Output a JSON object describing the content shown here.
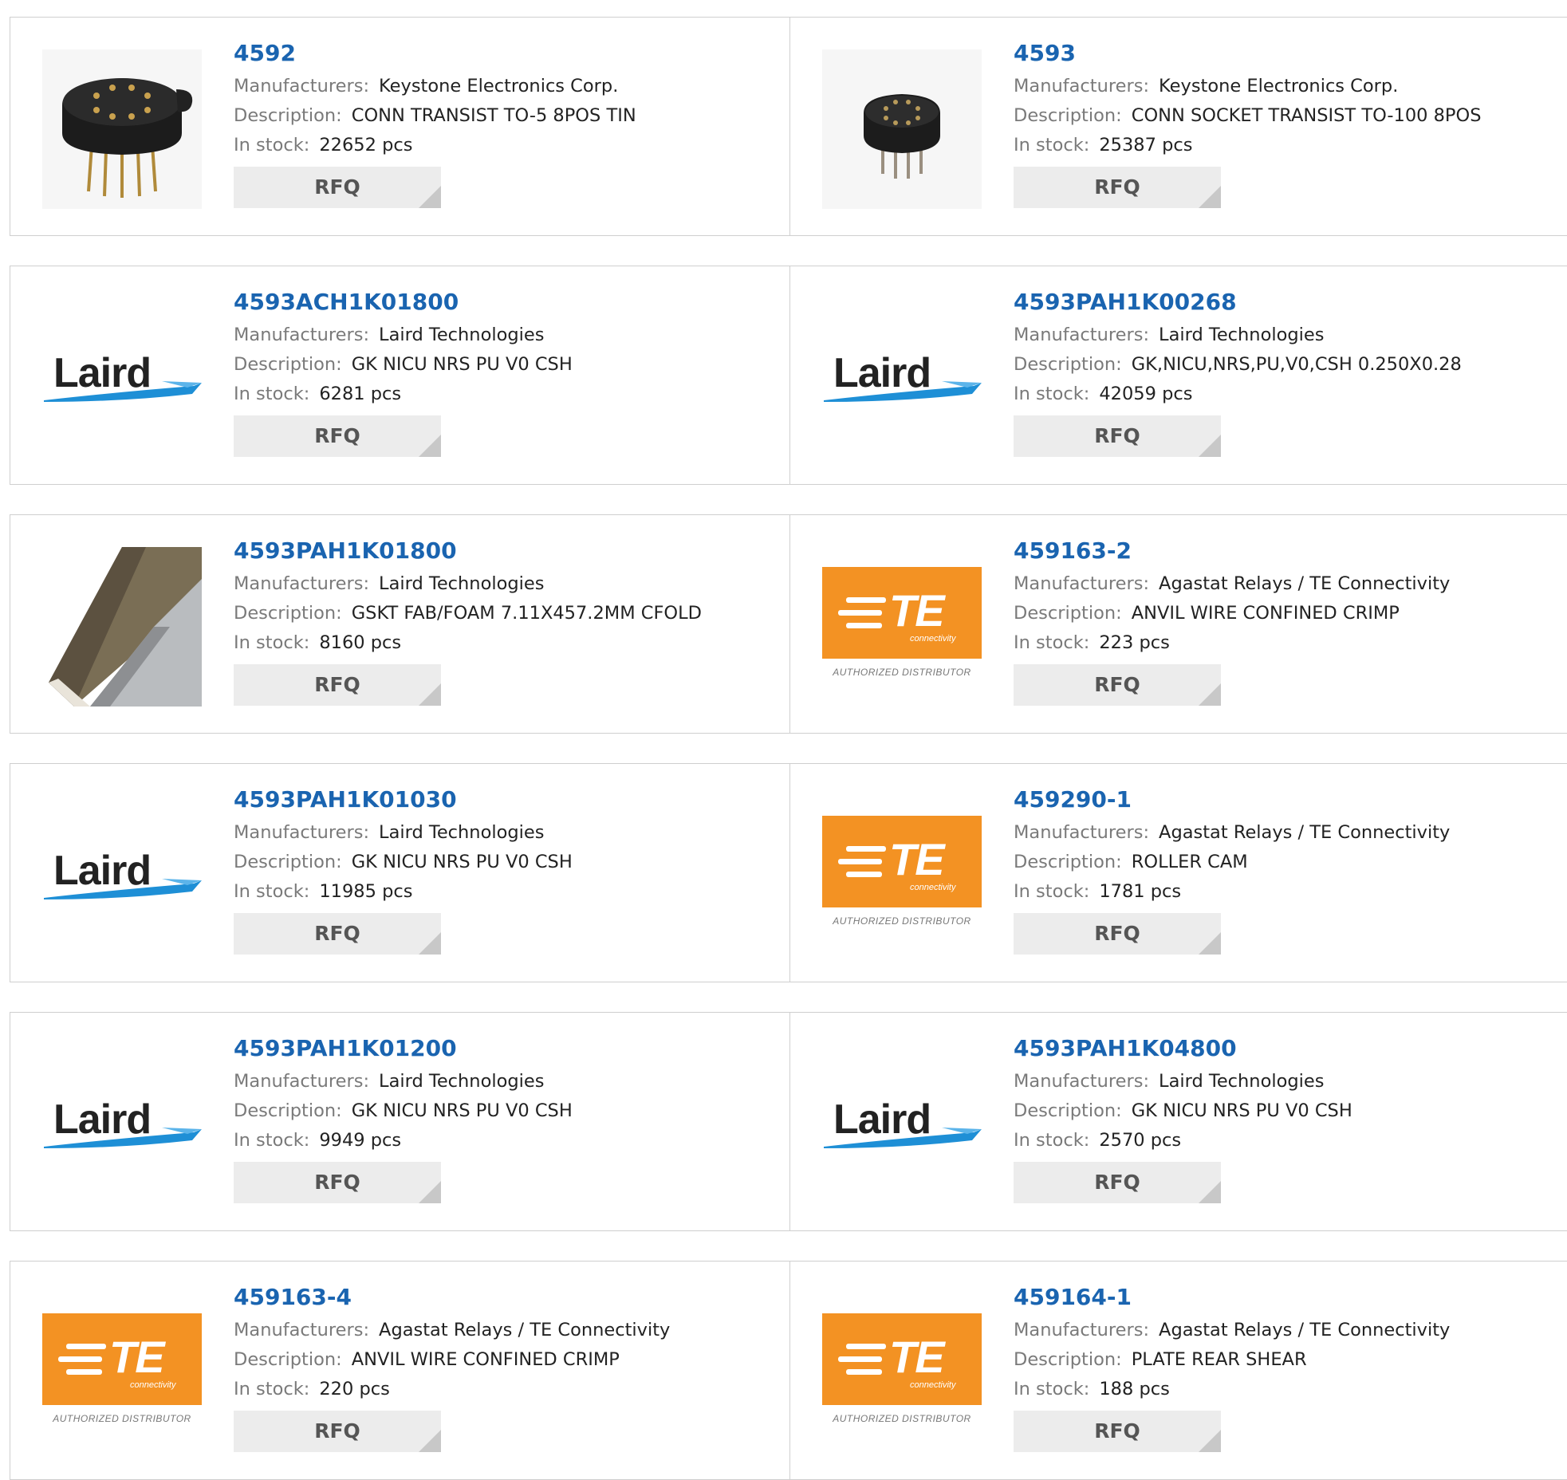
{
  "labels": {
    "manufacturers": "Manufacturers:",
    "description": "Description:",
    "in_stock": "In stock:",
    "rfq": "RFQ"
  },
  "logos": {
    "laird": "Laird",
    "te_mark": "TE",
    "te_sub": "connectivity",
    "te_authorized": "AUTHORIZED DISTRIBUTOR"
  },
  "colors": {
    "part_link": "#1a64b0",
    "te_orange": "#f39223",
    "laird_swoosh": "#1e8fd6",
    "rfq_bg": "#ececec"
  },
  "products": [
    {
      "part": "4592",
      "manufacturer": "Keystone Electronics Corp.",
      "description": "CONN TRANSIST TO-5 8POS TIN",
      "stock": "22652 pcs",
      "image": "socket-8pin-image"
    },
    {
      "part": "4593",
      "manufacturer": "Keystone Electronics Corp.",
      "description": "CONN SOCKET TRANSIST TO-100 8POS",
      "stock": "25387 pcs",
      "image": "socket-8pin-small-image"
    },
    {
      "part": "4593ACH1K01800",
      "manufacturer": "Laird Technologies",
      "description": "GK NICU NRS PU V0 CSH",
      "stock": "6281 pcs",
      "image": "laird-logo"
    },
    {
      "part": "4593PAH1K00268",
      "manufacturer": "Laird Technologies",
      "description": "GK,NICU,NRS,PU,V0,CSH 0.250X0.28",
      "stock": "42059 pcs",
      "image": "laird-logo"
    },
    {
      "part": "4593PAH1K01800",
      "manufacturer": "Laird Technologies",
      "description": "GSKT FAB/FOAM 7.11X457.2MM CFOLD",
      "stock": "8160 pcs",
      "image": "gasket-image"
    },
    {
      "part": "459163-2",
      "manufacturer": "Agastat Relays / TE Connectivity",
      "description": "ANVIL WIRE CONFINED CRIMP",
      "stock": "223 pcs",
      "image": "te-logo"
    },
    {
      "part": "4593PAH1K01030",
      "manufacturer": "Laird Technologies",
      "description": "GK NICU NRS PU V0 CSH",
      "stock": "11985 pcs",
      "image": "laird-logo"
    },
    {
      "part": "459290-1",
      "manufacturer": "Agastat Relays / TE Connectivity",
      "description": "ROLLER CAM",
      "stock": "1781 pcs",
      "image": "te-logo"
    },
    {
      "part": "4593PAH1K01200",
      "manufacturer": "Laird Technologies",
      "description": "GK NICU NRS PU V0 CSH",
      "stock": "9949 pcs",
      "image": "laird-logo"
    },
    {
      "part": "4593PAH1K04800",
      "manufacturer": "Laird Technologies",
      "description": "GK NICU NRS PU V0 CSH",
      "stock": "2570 pcs",
      "image": "laird-logo"
    },
    {
      "part": "459163-4",
      "manufacturer": "Agastat Relays / TE Connectivity",
      "description": "ANVIL WIRE CONFINED CRIMP",
      "stock": "220 pcs",
      "image": "te-logo"
    },
    {
      "part": "459164-1",
      "manufacturer": "Agastat Relays / TE Connectivity",
      "description": "PLATE REAR SHEAR",
      "stock": "188 pcs",
      "image": "te-logo"
    }
  ]
}
